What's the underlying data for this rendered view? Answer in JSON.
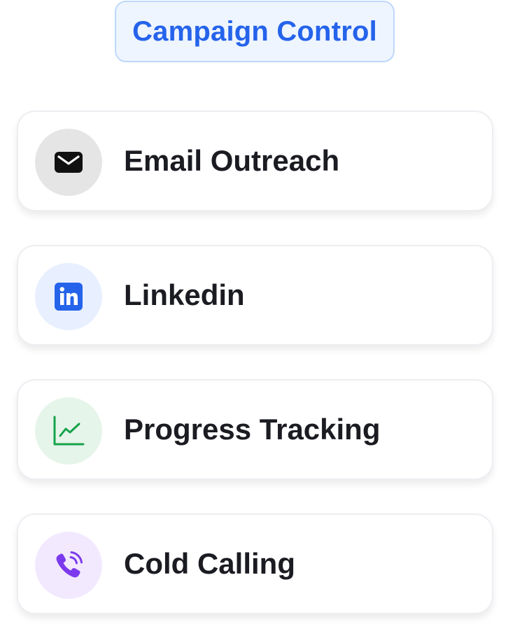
{
  "header": {
    "title": "Campaign Control",
    "accent_color": "#2563eb"
  },
  "items": [
    {
      "label": "Email Outreach",
      "icon": "envelope-icon",
      "icon_bg": "#e5e5e5",
      "icon_color": "#111111"
    },
    {
      "label": "Linkedin",
      "icon": "linkedin-icon",
      "icon_bg": "#e8efff",
      "icon_color": "#2563eb"
    },
    {
      "label": "Progress Tracking",
      "icon": "line-chart-icon",
      "icon_bg": "#e6f5ea",
      "icon_color": "#16a34a"
    },
    {
      "label": "Cold Calling",
      "icon": "phone-call-icon",
      "icon_bg": "#f2e9ff",
      "icon_color": "#7c3aed"
    }
  ]
}
